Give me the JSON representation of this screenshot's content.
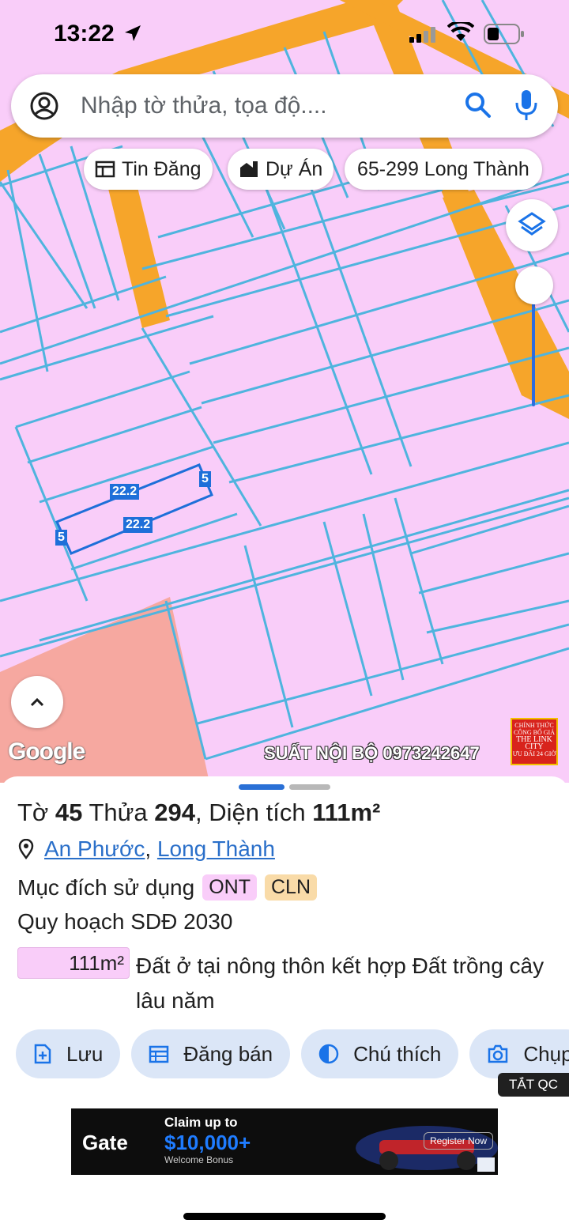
{
  "status_bar": {
    "time": "13:22"
  },
  "search": {
    "placeholder": "Nhập tờ thửa, tọa độ...."
  },
  "chips": [
    {
      "label": "Tin Đăng",
      "icon": "newspaper-icon"
    },
    {
      "label": "Dự Án",
      "icon": "buildings-icon"
    },
    {
      "label": "65-299 Long Thành",
      "icon": ""
    }
  ],
  "map": {
    "parcel_labels": [
      "22.2",
      "22.2",
      "5",
      "5"
    ],
    "google_logo": "Google",
    "watermark": "SUẤT NỘI BỘ 0973242647",
    "stamp": [
      "CHÍNH THỨC",
      "CÔNG BỐ GIÁ",
      "THE LINK",
      "CITY",
      "ƯU ĐÃI 24 GIỜ"
    ],
    "colors": {
      "residential": "#f9cdf9",
      "road": "#f6a52a",
      "boundary": "#4fb4de",
      "selected": "#1e6fd9",
      "other_zone": "#f6a8a0"
    }
  },
  "parcel": {
    "sheet_label": "Tờ",
    "sheet_no": "45",
    "plot_label": "Thửa",
    "plot_no": "294",
    "area_label": "Diện tích",
    "area": "111m²",
    "ward": "An Phước",
    "district": "Long Thành",
    "separator": ",",
    "purpose_label": "Mục đích sử dụng",
    "purposes": [
      "ONT",
      "CLN"
    ],
    "plan_label": "Quy hoạch SDĐ 2030",
    "plan_area": "111m²",
    "plan_desc": "Đất ở tại nông thôn kết hợp Đất trồng cây lâu năm"
  },
  "actions": [
    {
      "label": "Lưu",
      "icon": "add-file-icon"
    },
    {
      "label": "Đăng bán",
      "icon": "calendar-icon"
    },
    {
      "label": "Chú thích",
      "icon": "contrast-icon"
    },
    {
      "label": "Chụp",
      "icon": "camera-icon"
    }
  ],
  "ad": {
    "hide_label": "TẮT QC",
    "brand": "Gate",
    "claim": "Claim up to",
    "amount": "$10,000+",
    "bonus": "Welcome Bonus",
    "button": "Register Now"
  }
}
